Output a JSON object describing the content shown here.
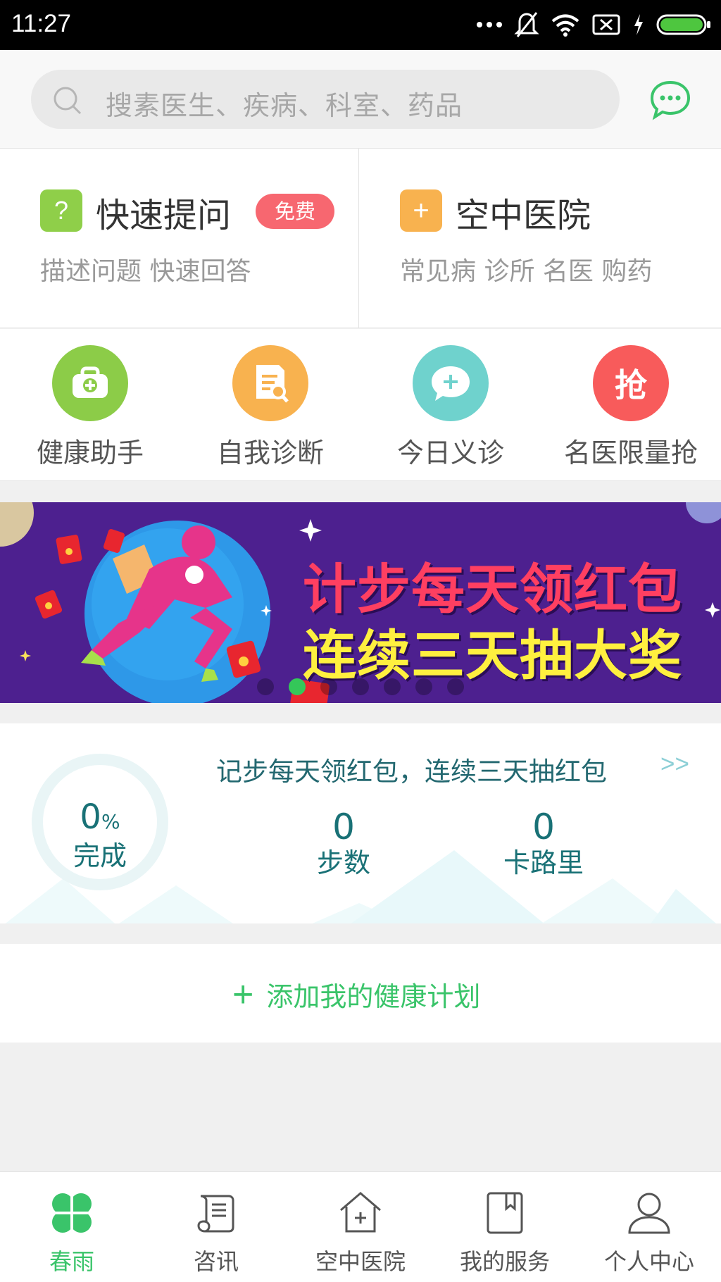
{
  "status_bar": {
    "time": "11:27"
  },
  "search": {
    "placeholder": "搜素医生、疾病、科室、药品"
  },
  "quick_cards": [
    {
      "title": "快速提问",
      "subtitle": "描述问题 快速回答",
      "icon": "question-icon",
      "icon_symbol": "?",
      "badge": "免费",
      "color": "#8fcf49"
    },
    {
      "title": "空中医院",
      "subtitle": "常见病 诊所 名医 购药",
      "icon": "plus-icon",
      "icon_symbol": "+",
      "color": "#f8b24f"
    }
  ],
  "features": [
    {
      "label": "健康助手",
      "icon": "medical-kit-icon",
      "color": "#8ccc48"
    },
    {
      "label": "自我诊断",
      "icon": "document-search-icon",
      "color": "#f8b24f"
    },
    {
      "label": "今日义诊",
      "icon": "chat-plus-icon",
      "color": "#6fd2cd"
    },
    {
      "label": "名医限量抢",
      "icon": "grab-icon",
      "icon_text": "抢",
      "color": "#f85b5b"
    }
  ],
  "banner": {
    "line1": "计步每天领红包",
    "line2": "连续三天抽大奖"
  },
  "step_card": {
    "promo_text": "记步每天领红包，连续三天抽红包",
    "promo_arrow": ">>",
    "progress_value": "0",
    "progress_unit": "%",
    "progress_label": "完成",
    "steps_value": "0",
    "steps_label": "步数",
    "calories_value": "0",
    "calories_label": "卡路里"
  },
  "plan": {
    "plus": "+",
    "label": "添加我的健康计划"
  },
  "bottom_nav": [
    {
      "label": "春雨",
      "icon": "clover-icon",
      "active": true
    },
    {
      "label": "咨讯",
      "icon": "scroll-news-icon"
    },
    {
      "label": "空中医院",
      "icon": "hospital-house-icon"
    },
    {
      "label": "我的服务",
      "icon": "bookmark-book-icon"
    },
    {
      "label": "个人中心",
      "icon": "person-icon"
    }
  ],
  "colors": {
    "accent_green": "#3ac46a",
    "teal_text": "#197176",
    "banner_purple": "#4d208f"
  }
}
